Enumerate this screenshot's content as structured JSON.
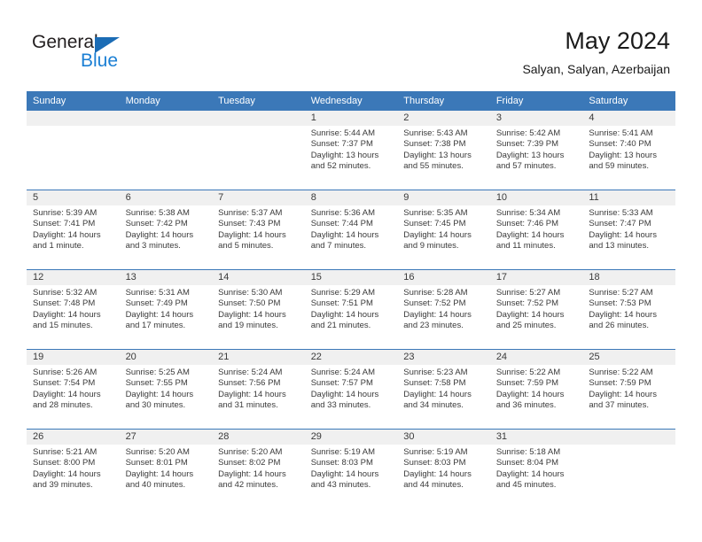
{
  "brand": {
    "name_part1": "General",
    "name_part2": "Blue",
    "triangle_color": "#1b6cb5",
    "blue_text_color": "#1b7fd4"
  },
  "header": {
    "title": "May 2024",
    "subtitle": "Salyan, Salyan, Azerbaijan"
  },
  "theme": {
    "header_bg": "#3b78b8",
    "daynum_band_bg": "#f0f0f0",
    "row_divider": "#3b78b8",
    "text_color": "#3a3a3a"
  },
  "weekday_headers": [
    "Sunday",
    "Monday",
    "Tuesday",
    "Wednesday",
    "Thursday",
    "Friday",
    "Saturday"
  ],
  "labels": {
    "sunrise_prefix": "Sunrise:",
    "sunset_prefix": "Sunset:",
    "daylight_prefix": "Daylight:"
  },
  "weeks": [
    [
      {
        "day": "",
        "empty": true
      },
      {
        "day": "",
        "empty": true
      },
      {
        "day": "",
        "empty": true
      },
      {
        "day": "1",
        "sunrise": "Sunrise: 5:44 AM",
        "sunset": "Sunset: 7:37 PM",
        "daylight_line1": "Daylight: 13 hours",
        "daylight_line2": "and 52 minutes."
      },
      {
        "day": "2",
        "sunrise": "Sunrise: 5:43 AM",
        "sunset": "Sunset: 7:38 PM",
        "daylight_line1": "Daylight: 13 hours",
        "daylight_line2": "and 55 minutes."
      },
      {
        "day": "3",
        "sunrise": "Sunrise: 5:42 AM",
        "sunset": "Sunset: 7:39 PM",
        "daylight_line1": "Daylight: 13 hours",
        "daylight_line2": "and 57 minutes."
      },
      {
        "day": "4",
        "sunrise": "Sunrise: 5:41 AM",
        "sunset": "Sunset: 7:40 PM",
        "daylight_line1": "Daylight: 13 hours",
        "daylight_line2": "and 59 minutes."
      }
    ],
    [
      {
        "day": "5",
        "sunrise": "Sunrise: 5:39 AM",
        "sunset": "Sunset: 7:41 PM",
        "daylight_line1": "Daylight: 14 hours",
        "daylight_line2": "and 1 minute."
      },
      {
        "day": "6",
        "sunrise": "Sunrise: 5:38 AM",
        "sunset": "Sunset: 7:42 PM",
        "daylight_line1": "Daylight: 14 hours",
        "daylight_line2": "and 3 minutes."
      },
      {
        "day": "7",
        "sunrise": "Sunrise: 5:37 AM",
        "sunset": "Sunset: 7:43 PM",
        "daylight_line1": "Daylight: 14 hours",
        "daylight_line2": "and 5 minutes."
      },
      {
        "day": "8",
        "sunrise": "Sunrise: 5:36 AM",
        "sunset": "Sunset: 7:44 PM",
        "daylight_line1": "Daylight: 14 hours",
        "daylight_line2": "and 7 minutes."
      },
      {
        "day": "9",
        "sunrise": "Sunrise: 5:35 AM",
        "sunset": "Sunset: 7:45 PM",
        "daylight_line1": "Daylight: 14 hours",
        "daylight_line2": "and 9 minutes."
      },
      {
        "day": "10",
        "sunrise": "Sunrise: 5:34 AM",
        "sunset": "Sunset: 7:46 PM",
        "daylight_line1": "Daylight: 14 hours",
        "daylight_line2": "and 11 minutes."
      },
      {
        "day": "11",
        "sunrise": "Sunrise: 5:33 AM",
        "sunset": "Sunset: 7:47 PM",
        "daylight_line1": "Daylight: 14 hours",
        "daylight_line2": "and 13 minutes."
      }
    ],
    [
      {
        "day": "12",
        "sunrise": "Sunrise: 5:32 AM",
        "sunset": "Sunset: 7:48 PM",
        "daylight_line1": "Daylight: 14 hours",
        "daylight_line2": "and 15 minutes."
      },
      {
        "day": "13",
        "sunrise": "Sunrise: 5:31 AM",
        "sunset": "Sunset: 7:49 PM",
        "daylight_line1": "Daylight: 14 hours",
        "daylight_line2": "and 17 minutes."
      },
      {
        "day": "14",
        "sunrise": "Sunrise: 5:30 AM",
        "sunset": "Sunset: 7:50 PM",
        "daylight_line1": "Daylight: 14 hours",
        "daylight_line2": "and 19 minutes."
      },
      {
        "day": "15",
        "sunrise": "Sunrise: 5:29 AM",
        "sunset": "Sunset: 7:51 PM",
        "daylight_line1": "Daylight: 14 hours",
        "daylight_line2": "and 21 minutes."
      },
      {
        "day": "16",
        "sunrise": "Sunrise: 5:28 AM",
        "sunset": "Sunset: 7:52 PM",
        "daylight_line1": "Daylight: 14 hours",
        "daylight_line2": "and 23 minutes."
      },
      {
        "day": "17",
        "sunrise": "Sunrise: 5:27 AM",
        "sunset": "Sunset: 7:52 PM",
        "daylight_line1": "Daylight: 14 hours",
        "daylight_line2": "and 25 minutes."
      },
      {
        "day": "18",
        "sunrise": "Sunrise: 5:27 AM",
        "sunset": "Sunset: 7:53 PM",
        "daylight_line1": "Daylight: 14 hours",
        "daylight_line2": "and 26 minutes."
      }
    ],
    [
      {
        "day": "19",
        "sunrise": "Sunrise: 5:26 AM",
        "sunset": "Sunset: 7:54 PM",
        "daylight_line1": "Daylight: 14 hours",
        "daylight_line2": "and 28 minutes."
      },
      {
        "day": "20",
        "sunrise": "Sunrise: 5:25 AM",
        "sunset": "Sunset: 7:55 PM",
        "daylight_line1": "Daylight: 14 hours",
        "daylight_line2": "and 30 minutes."
      },
      {
        "day": "21",
        "sunrise": "Sunrise: 5:24 AM",
        "sunset": "Sunset: 7:56 PM",
        "daylight_line1": "Daylight: 14 hours",
        "daylight_line2": "and 31 minutes."
      },
      {
        "day": "22",
        "sunrise": "Sunrise: 5:24 AM",
        "sunset": "Sunset: 7:57 PM",
        "daylight_line1": "Daylight: 14 hours",
        "daylight_line2": "and 33 minutes."
      },
      {
        "day": "23",
        "sunrise": "Sunrise: 5:23 AM",
        "sunset": "Sunset: 7:58 PM",
        "daylight_line1": "Daylight: 14 hours",
        "daylight_line2": "and 34 minutes."
      },
      {
        "day": "24",
        "sunrise": "Sunrise: 5:22 AM",
        "sunset": "Sunset: 7:59 PM",
        "daylight_line1": "Daylight: 14 hours",
        "daylight_line2": "and 36 minutes."
      },
      {
        "day": "25",
        "sunrise": "Sunrise: 5:22 AM",
        "sunset": "Sunset: 7:59 PM",
        "daylight_line1": "Daylight: 14 hours",
        "daylight_line2": "and 37 minutes."
      }
    ],
    [
      {
        "day": "26",
        "sunrise": "Sunrise: 5:21 AM",
        "sunset": "Sunset: 8:00 PM",
        "daylight_line1": "Daylight: 14 hours",
        "daylight_line2": "and 39 minutes."
      },
      {
        "day": "27",
        "sunrise": "Sunrise: 5:20 AM",
        "sunset": "Sunset: 8:01 PM",
        "daylight_line1": "Daylight: 14 hours",
        "daylight_line2": "and 40 minutes."
      },
      {
        "day": "28",
        "sunrise": "Sunrise: 5:20 AM",
        "sunset": "Sunset: 8:02 PM",
        "daylight_line1": "Daylight: 14 hours",
        "daylight_line2": "and 42 minutes."
      },
      {
        "day": "29",
        "sunrise": "Sunrise: 5:19 AM",
        "sunset": "Sunset: 8:03 PM",
        "daylight_line1": "Daylight: 14 hours",
        "daylight_line2": "and 43 minutes."
      },
      {
        "day": "30",
        "sunrise": "Sunrise: 5:19 AM",
        "sunset": "Sunset: 8:03 PM",
        "daylight_line1": "Daylight: 14 hours",
        "daylight_line2": "and 44 minutes."
      },
      {
        "day": "31",
        "sunrise": "Sunrise: 5:18 AM",
        "sunset": "Sunset: 8:04 PM",
        "daylight_line1": "Daylight: 14 hours",
        "daylight_line2": "and 45 minutes."
      },
      {
        "day": "",
        "empty": true
      }
    ]
  ]
}
